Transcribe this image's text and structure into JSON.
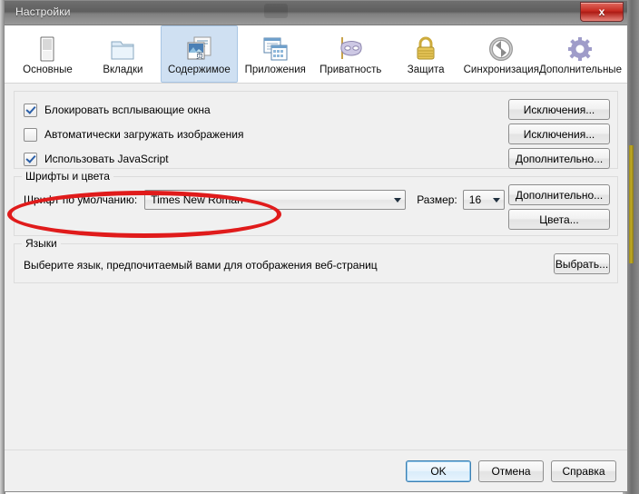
{
  "window": {
    "title": "Настройки",
    "close_label": "x"
  },
  "toolbar": {
    "tabs": [
      {
        "label": "Основные",
        "icon": "browser-window-icon",
        "selected": false
      },
      {
        "label": "Вкладки",
        "icon": "folder-tabs-icon",
        "selected": false
      },
      {
        "label": "Содержимое",
        "icon": "content-page-icon",
        "selected": true
      },
      {
        "label": "Приложения",
        "icon": "applications-icon",
        "selected": false
      },
      {
        "label": "Приватность",
        "icon": "mask-icon",
        "selected": false
      },
      {
        "label": "Защита",
        "icon": "padlock-icon",
        "selected": false
      },
      {
        "label": "Синхронизация",
        "icon": "sync-arrows-icon",
        "selected": false
      },
      {
        "label": "Дополнительные",
        "icon": "gear-icon",
        "selected": false
      }
    ]
  },
  "content": {
    "checkboxes": [
      {
        "label": "Блокировать всплывающие окна",
        "checked": true,
        "accel": "Б"
      },
      {
        "label": "Автоматически загружать изображения",
        "checked": false,
        "accel": "и"
      },
      {
        "label": "Использовать JavaScript",
        "checked": true,
        "accel": "з"
      }
    ],
    "side_buttons": [
      {
        "label": "Исключения..."
      },
      {
        "label": "Исключения..."
      },
      {
        "label": "Дополнительно..."
      }
    ],
    "fonts_group": {
      "legend": "Шрифты и цвета",
      "font_label": "Шрифт по умолчанию:",
      "font_value": "Times New Roman",
      "size_label": "Размер:",
      "size_value": "16",
      "buttons": [
        {
          "label": "Дополнительно..."
        },
        {
          "label": "Цвета..."
        }
      ]
    },
    "languages_group": {
      "legend": "Языки",
      "text": "Выберите язык, предпочитаемый вами для отображения веб-страниц",
      "button": {
        "label": "Выбрать..."
      }
    }
  },
  "footer": {
    "ok": "OK",
    "cancel": "Отмена",
    "help": "Справка"
  },
  "annotation": {
    "shape": "red-ellipse-highlight",
    "color": "#e01b1b",
    "targets": "Автоматически загружать изображения"
  }
}
